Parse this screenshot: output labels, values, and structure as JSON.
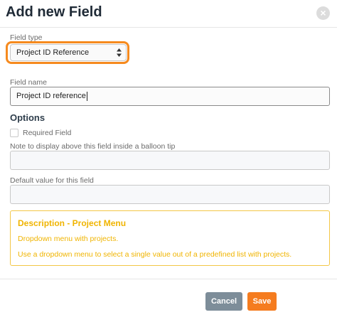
{
  "dialog": {
    "title": "Add new Field",
    "close_icon": "close-icon"
  },
  "field_type": {
    "label": "Field type",
    "selected": "Project ID Reference",
    "highlight_color": "#f68a1e"
  },
  "field_name": {
    "label": "Field name",
    "value": "Project ID reference"
  },
  "options": {
    "heading": "Options",
    "required_label": "Required Field",
    "required_checked": false,
    "balloon_label": "Note to display above this field inside a balloon tip",
    "balloon_value": "",
    "default_label": "Default value for this field",
    "default_value": ""
  },
  "description": {
    "title": "Description - Project Menu",
    "line1": "Dropdown menu with projects.",
    "line2": "Use a dropdown menu to select a single value out of a predefined list with projects.",
    "color": "#f0b400"
  },
  "footer": {
    "cancel_label": "Cancel",
    "save_label": "Save",
    "cancel_color": "#7d8d99",
    "save_color": "#f57c1f"
  }
}
